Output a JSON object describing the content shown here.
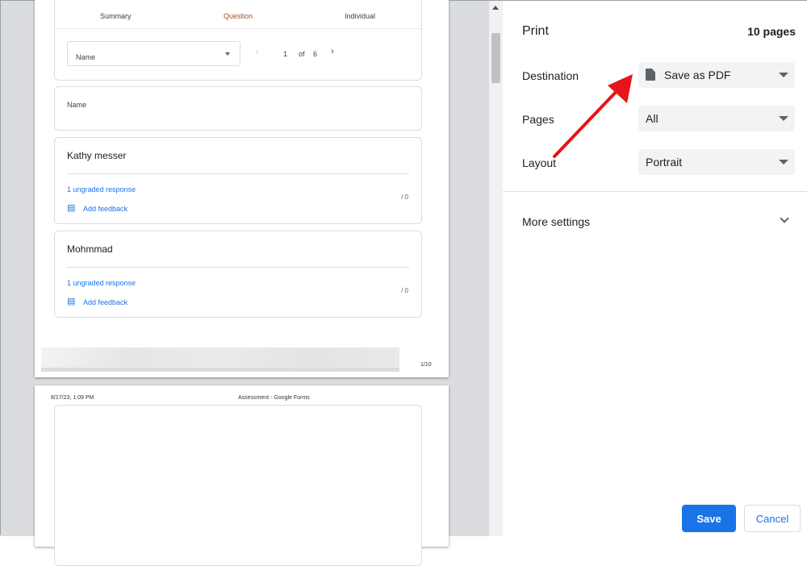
{
  "preview": {
    "tabs": [
      "Summary",
      "Question",
      "Individual"
    ],
    "question_select": "Name",
    "pager": {
      "current": "1",
      "of": "of",
      "total": "6"
    },
    "question_title": "Name",
    "responses": [
      {
        "name": "Kathy messer",
        "status": "1 ungraded response",
        "feedback": "Add feedback",
        "score": "/ 0"
      },
      {
        "name": "Mohmmad",
        "status": "1 ungraded response",
        "feedback": "Add feedback",
        "score": "/ 0"
      }
    ],
    "page_number": "1/10",
    "page2_header": {
      "date": "8/17/23, 1:09 PM",
      "title": "Assessment - Google Forms"
    }
  },
  "panel": {
    "title": "Print",
    "page_count": "10 pages",
    "destination": {
      "label": "Destination",
      "value": "Save as PDF"
    },
    "pages": {
      "label": "Pages",
      "value": "All"
    },
    "layout": {
      "label": "Layout",
      "value": "Portrait"
    },
    "more_settings": "More settings",
    "save": "Save",
    "cancel": "Cancel"
  },
  "colors": {
    "accent": "#1a73e8",
    "active_tab": "#a0522d",
    "arrow": "#e8141c"
  }
}
